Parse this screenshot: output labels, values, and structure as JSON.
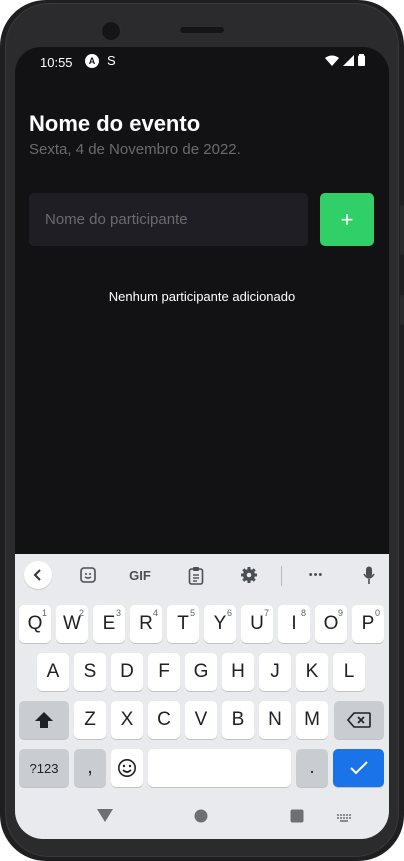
{
  "status_bar": {
    "time": "10:55",
    "icon_a": "A",
    "icon_s": "S"
  },
  "event": {
    "title": "Nome do evento",
    "date": "Sexta, 4 de Novembro de 2022."
  },
  "participant_input": {
    "placeholder": "Nome do participante",
    "value": ""
  },
  "add_button": {
    "label": "+"
  },
  "empty_list_message": "Nenhum participante adicionado",
  "keyboard": {
    "toolbar": {
      "back_icon": "chevron-left-icon",
      "gif_label": "GIF",
      "more_label": "•••"
    },
    "row1": [
      {
        "key": "Q",
        "sup": "1"
      },
      {
        "key": "W",
        "sup": "2"
      },
      {
        "key": "E",
        "sup": "3"
      },
      {
        "key": "R",
        "sup": "4"
      },
      {
        "key": "T",
        "sup": "5"
      },
      {
        "key": "Y",
        "sup": "6"
      },
      {
        "key": "U",
        "sup": "7"
      },
      {
        "key": "I",
        "sup": "8"
      },
      {
        "key": "O",
        "sup": "9"
      },
      {
        "key": "P",
        "sup": "0"
      }
    ],
    "row2": [
      "A",
      "S",
      "D",
      "F",
      "G",
      "H",
      "J",
      "K",
      "L"
    ],
    "row3": [
      "Z",
      "X",
      "C",
      "V",
      "B",
      "N",
      "M"
    ],
    "symbols_label": "?123",
    "comma_label": ",",
    "period_label": ".",
    "enter_icon": "check-icon"
  },
  "colors": {
    "background": "#121214",
    "input_bg": "#1f1e25",
    "accent": "#31cf67",
    "muted_text": "#6b6b6b",
    "enter_key": "#1a73e8"
  }
}
